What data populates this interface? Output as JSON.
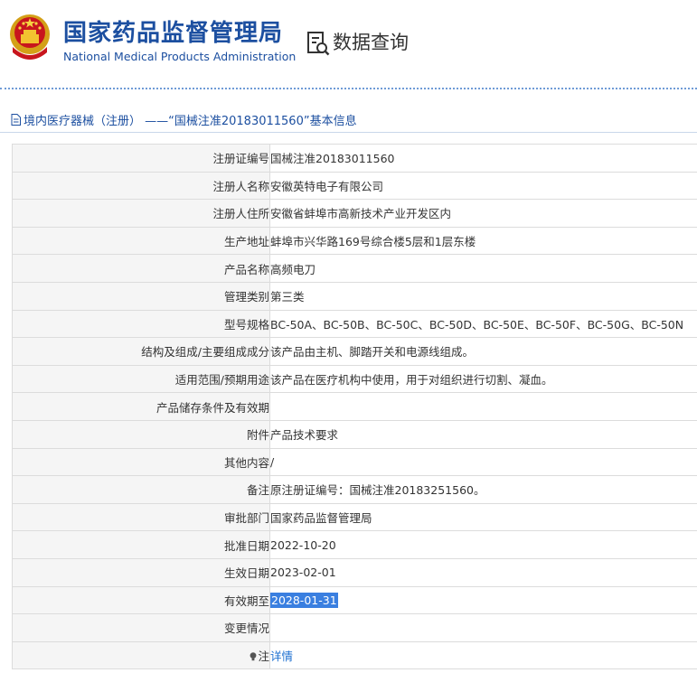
{
  "header": {
    "org_name_cn": "国家药品监督管理局",
    "org_name_en": "National Medical Products Administration",
    "query_title": "数据查询"
  },
  "breadcrumb": {
    "text": "境内医疗器械（注册） ——“国械注准20183011560”基本信息"
  },
  "rows": [
    {
      "label": "注册证编号",
      "value": "国械注准20183011560"
    },
    {
      "label": "注册人名称",
      "value": "安徽英特电子有限公司"
    },
    {
      "label": "注册人住所",
      "value": "安徽省蚌埠市高新技术产业开发区内"
    },
    {
      "label": "生产地址",
      "value": "蚌埠市兴华路169号综合楼5层和1层东楼"
    },
    {
      "label": "产品名称",
      "value": "高频电刀"
    },
    {
      "label": "管理类别",
      "value": "第三类"
    },
    {
      "label": "型号规格",
      "value": "BC-50A、BC-50B、BC-50C、BC-50D、BC-50E、BC-50F、BC-50G、BC-50N"
    },
    {
      "label": "结构及组成/主要组成成分",
      "value": "该产品由主机、脚踏开关和电源线组成。"
    },
    {
      "label": "适用范围/预期用途",
      "value": "该产品在医疗机构中使用，用于对组织进行切割、凝血。"
    },
    {
      "label": "产品储存条件及有效期",
      "value": ""
    },
    {
      "label": "附件",
      "value": "产品技术要求"
    },
    {
      "label": "其他内容",
      "value": "/"
    },
    {
      "label": "备注",
      "value": "原注册证编号：国械注准20183251560。"
    },
    {
      "label": "审批部门",
      "value": "国家药品监督管理局"
    },
    {
      "label": "批准日期",
      "value": "2022-10-20"
    },
    {
      "label": "生效日期",
      "value": "2023-02-01"
    },
    {
      "label": "有效期至",
      "value": "2028-01-31"
    },
    {
      "label": "变更情况",
      "value": ""
    },
    {
      "label": "注",
      "value": "详情"
    }
  ],
  "colors": {
    "brand_blue": "#1c4fa0",
    "selection_highlight": "#3a7fe0",
    "link": "#1c6fd0",
    "label_bg": "#f5f5f5"
  },
  "icons": {
    "emblem": "national-emblem-icon",
    "query": "search-document-icon",
    "breadcrumb": "document-icon",
    "note": "lightbulb-icon"
  }
}
